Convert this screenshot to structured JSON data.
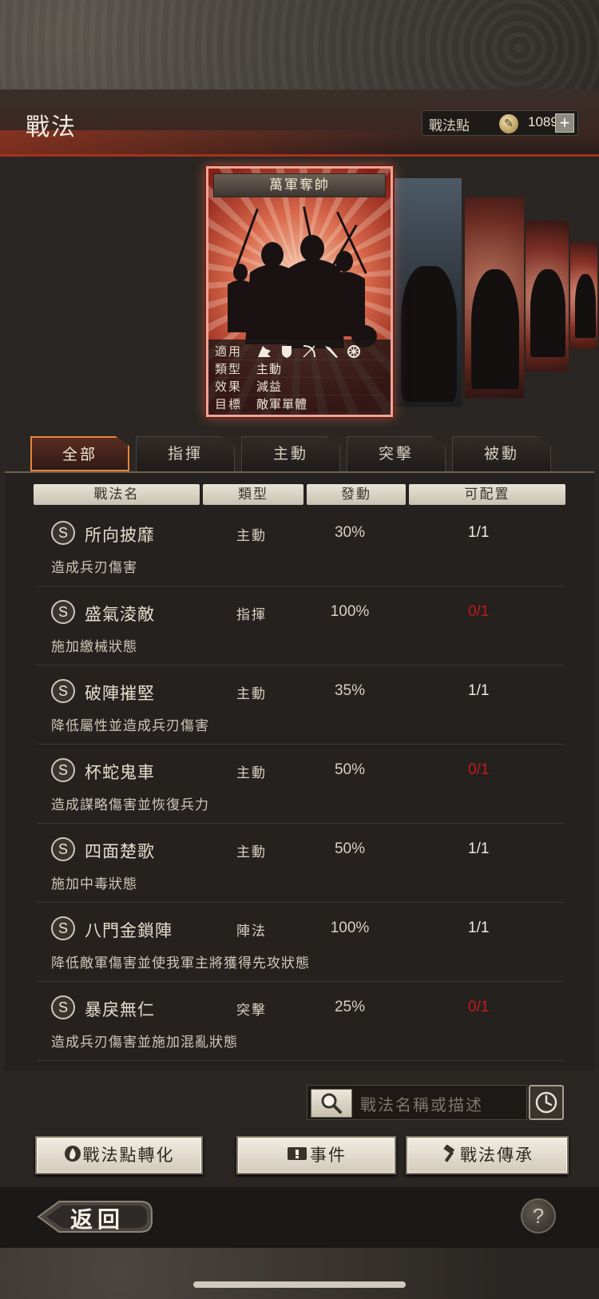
{
  "header": {
    "title": "戰法",
    "points_label": "戰法點",
    "points_icon": "feather-coin-icon",
    "points_value": "1089",
    "plus_label": "+"
  },
  "card": {
    "name": "萬軍奪帥",
    "rows": [
      {
        "key": "適用",
        "value": ""
      },
      {
        "key": "類型",
        "value": "主動"
      },
      {
        "key": "效果",
        "value": "減益"
      },
      {
        "key": "目標",
        "value": "敵軍單體"
      }
    ],
    "arms_icons": [
      "cavalry-icon",
      "shield-icon",
      "bow-icon",
      "spear-icon",
      "wheel-icon"
    ]
  },
  "tabs": [
    "全部",
    "指揮",
    "主動",
    "突擊",
    "被動"
  ],
  "active_tab": "全部",
  "columns": [
    "戰法名",
    "類型",
    "發動",
    "可配置"
  ],
  "tactics": [
    {
      "grade": "S",
      "name": "所向披靡",
      "type": "主動",
      "rate": "30%",
      "slots": "1/1",
      "slots_color": "#f0ece4",
      "desc": "造成兵刃傷害"
    },
    {
      "grade": "S",
      "name": "盛氣淩敵",
      "type": "指揮",
      "rate": "100%",
      "slots": "0/1",
      "slots_color": "#c41a1a",
      "desc": "施加繳械狀態"
    },
    {
      "grade": "S",
      "name": "破陣摧堅",
      "type": "主動",
      "rate": "35%",
      "slots": "1/1",
      "slots_color": "#f0ece4",
      "desc": "降低屬性並造成兵刃傷害"
    },
    {
      "grade": "S",
      "name": "杯蛇鬼車",
      "type": "主動",
      "rate": "50%",
      "slots": "0/1",
      "slots_color": "#c41a1a",
      "desc": "造成謀略傷害並恢復兵力"
    },
    {
      "grade": "S",
      "name": "四面楚歌",
      "type": "主動",
      "rate": "50%",
      "slots": "1/1",
      "slots_color": "#f0ece4",
      "desc": "施加中毒狀態"
    },
    {
      "grade": "S",
      "name": "八門金鎖陣",
      "type": "陣法",
      "rate": "100%",
      "slots": "1/1",
      "slots_color": "#f0ece4",
      "desc": "降低敵軍傷害並使我軍主將獲得先攻狀態"
    },
    {
      "grade": "S",
      "name": "暴戾無仁",
      "type": "突擊",
      "rate": "25%",
      "slots": "0/1",
      "slots_color": "#c41a1a",
      "desc": "造成兵刃傷害並施加混亂狀態"
    }
  ],
  "search": {
    "placeholder": "戰法名稱或描述",
    "search_icon": "magnifier-icon",
    "history_icon": "clock-icon"
  },
  "buttons": {
    "convert": "戰法點轉化",
    "events": "事件",
    "inherit": "戰法傳承"
  },
  "footer": {
    "back": "返回",
    "help": "?"
  }
}
